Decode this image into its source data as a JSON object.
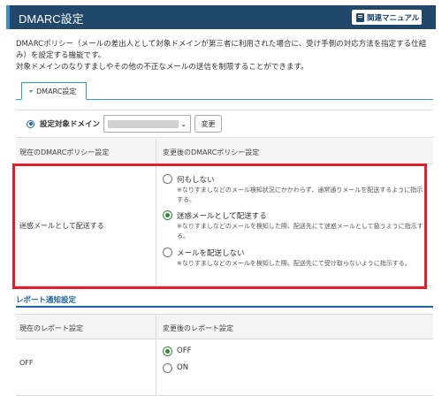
{
  "header": {
    "title": "DMARC設定",
    "manual_label": "関連マニュアル"
  },
  "description": {
    "line1": "DMARCポリシー（メールの差出人として対象ドメインが第三者に利用された場合に、受け手側の対応方法を指定する仕組",
    "line2": "み）を設定する機能です。",
    "line3": "対象ドメインのなりすましやその他の不正なメールの送信を制限することができます。"
  },
  "tab": {
    "label": "DMARC設定"
  },
  "domain": {
    "label": "設定対象ドメイン",
    "selected_value": "",
    "change_label": "変更"
  },
  "policy": {
    "current_header": "現在のDMARCポリシー設定",
    "new_header": "変更後のDMARCポリシー設定",
    "current_value": "迷惑メールとして配送する",
    "options": [
      {
        "label": "何もしない",
        "note": "※なりすましなどのメール検知状況にかかわらず、通常通りメールを配送するように指示する。",
        "selected": false
      },
      {
        "label": "迷惑メールとして配送する",
        "note": "※なりすましなどのメールを検知した際、配送先にて迷惑メールとして扱うように指示する。",
        "selected": true
      },
      {
        "label": "メールを配送しない",
        "note": "※なりすましなどのメールを検知した際、配送先にて受け取らないように指示する。",
        "selected": false
      }
    ]
  },
  "report": {
    "title": "レポート通知設定",
    "current_header": "現在のレポート設定",
    "new_header": "変更後のレポート設定",
    "current_value": "OFF",
    "options": [
      {
        "label": "OFF",
        "selected": true
      },
      {
        "label": "ON",
        "selected": false
      }
    ]
  },
  "colors": {
    "header_bg": "#21476a",
    "accent": "#1c63a8",
    "highlight_frame": "#e0202c",
    "radio_selected": "#2e8a3e"
  }
}
